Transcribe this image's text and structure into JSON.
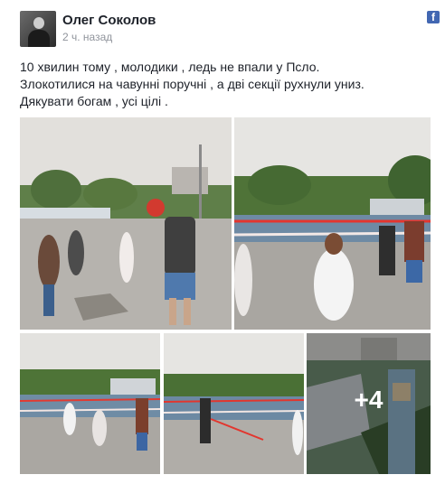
{
  "post": {
    "author": "Олег Соколов",
    "time": "2 ч. назад",
    "text_lines": [
      "10 хвилин тому , молодики , ледь не впали у Псло.",
      "Злокотилися на чавунні поручні , а дві секції рухнули униз.",
      "Дякувати богам , усі цілі ."
    ],
    "more_photos_label": "+4"
  },
  "icons": {
    "facebook": "facebook-icon"
  },
  "colors": {
    "brand": "#4267b2",
    "meta": "#90949c",
    "text": "#1d2129"
  }
}
